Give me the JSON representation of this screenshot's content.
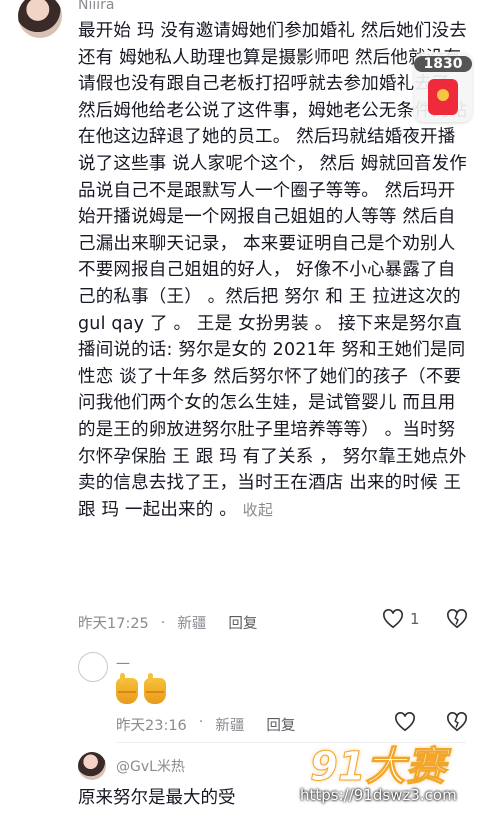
{
  "comment": {
    "username": "Niiira",
    "text": "最开始 玛 没有邀请姆她们参加婚礼  然后她们没去  还有 姆她私人助理也算是摄影师吧 然后他就没有请假也没有跟自己老板打招呼就去参加婚礼去了， 然后姆他给老公说了这件事，姆她老公无条件的站在他这边辞退了她的员工。  然后玛就结婚夜开播说了这些事 说人家呢个这个，  然后 姆就回音发作品说自己不是跟默写人一个圈子等等。  然后玛开始开播说姆是一个网报自己姐姐的人等等 然后自己漏出来聊天记录， 本来要证明自己是个劝别人不要网报自己姐姐的好人， 好像不小心暴露了自己的私事（王） 。然后把 努尔  和 王 拉进这次的gul qay 了 。 王是 女扮男装 。 接下来是努尔直播间说的话:  努尔是女的 2021年 努和王她们是同性恋 谈了十年多  然后努尔怀了她们的孩子（不要问我他们两个女的怎么生娃，是试管婴儿 而且用的是王的卵放进努尔肚子里培养等等）  。当时努尔怀孕保胎  王 跟 玛 有了关系  ， 努尔靠王她点外卖的信息去找了王，当时王在酒店 出来的时候 王 跟 玛 一起出来的 。",
    "collapse_label": "收起",
    "time": "昨天17:25",
    "location": "新疆",
    "reply_label": "回复",
    "likes": "1"
  },
  "reply": {
    "username": "一",
    "time": "昨天23:16",
    "location": "新疆",
    "reply_label": "回复"
  },
  "next_comment": {
    "username": "@GvL米热",
    "text": "原来努尔是最大的受"
  },
  "badge": {
    "count": "1830"
  },
  "watermark": {
    "brand": "91大赛",
    "url": "https://91dswz3.com"
  },
  "colors": {
    "text": "#161823",
    "meta": "#8a8b91",
    "accent": "#ee2a3b"
  }
}
